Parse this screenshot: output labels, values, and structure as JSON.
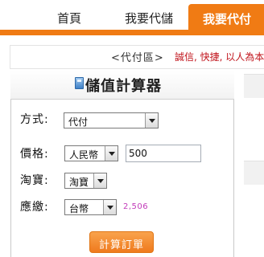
{
  "nav": {
    "tabs": [
      {
        "label": "首頁"
      },
      {
        "label": "我要代儲"
      },
      {
        "label": "我要代付"
      }
    ],
    "accent_color": "#f07b14"
  },
  "slogan": {
    "section": "<代付區>",
    "text": "誠信, 快捷, 以人為本"
  },
  "calculator": {
    "title": "儲值計算器",
    "icon": "calculator-icon",
    "method": {
      "label": "方式:",
      "value": "代付"
    },
    "price": {
      "label": "價格:",
      "currency": "人民幣",
      "amount": "500"
    },
    "taobao": {
      "label": "淘寶:",
      "value": "淘寶"
    },
    "payable": {
      "label": "應繳:",
      "currency": "台幣",
      "result": "2,506"
    },
    "button_label": "計算訂單"
  }
}
